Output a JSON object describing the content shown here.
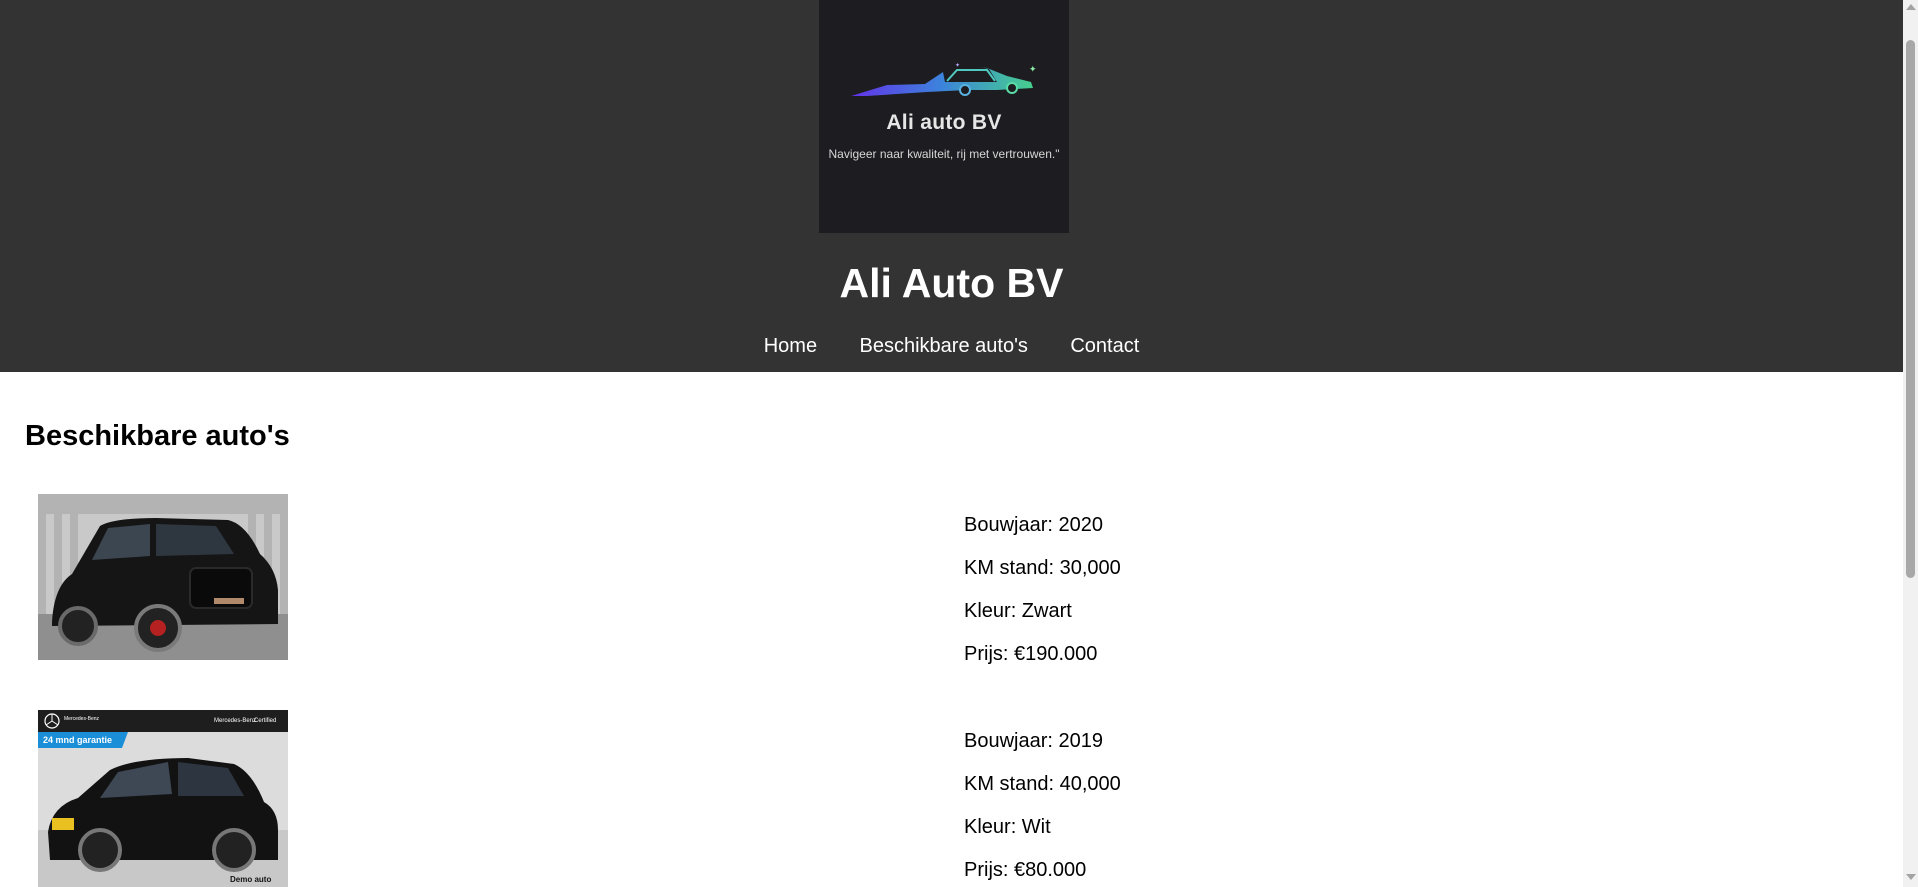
{
  "logo": {
    "name": "Ali auto BV",
    "tagline": "Navigeer naar kwaliteit, rij met vertrouwen.\""
  },
  "site_title": "Ali Auto BV",
  "nav": [
    {
      "label": "Home"
    },
    {
      "label": "Beschikbare auto's"
    },
    {
      "label": "Contact"
    }
  ],
  "section_title": "Beschikbare auto's",
  "cars": [
    {
      "photo": {
        "badge": "",
        "brand": "",
        "plate": "",
        "corner": ""
      },
      "specs": [
        "Bouwjaar: 2020",
        "KM stand: 30,000",
        "Kleur: Zwart",
        "Prijs: €190.000"
      ]
    },
    {
      "photo": {
        "badge": "24 mnd garantie",
        "brand": "Mercedes-Benz",
        "certified": "Certified",
        "plate": "",
        "corner": "Demo auto"
      },
      "specs": [
        "Bouwjaar: 2019",
        "KM stand: 40,000",
        "Kleur: Wit",
        "Prijs: €80.000"
      ]
    }
  ],
  "colors": {
    "header_bg": "#333333",
    "logo_bg": "#1d1c21",
    "page_bg": "#ffffff"
  }
}
